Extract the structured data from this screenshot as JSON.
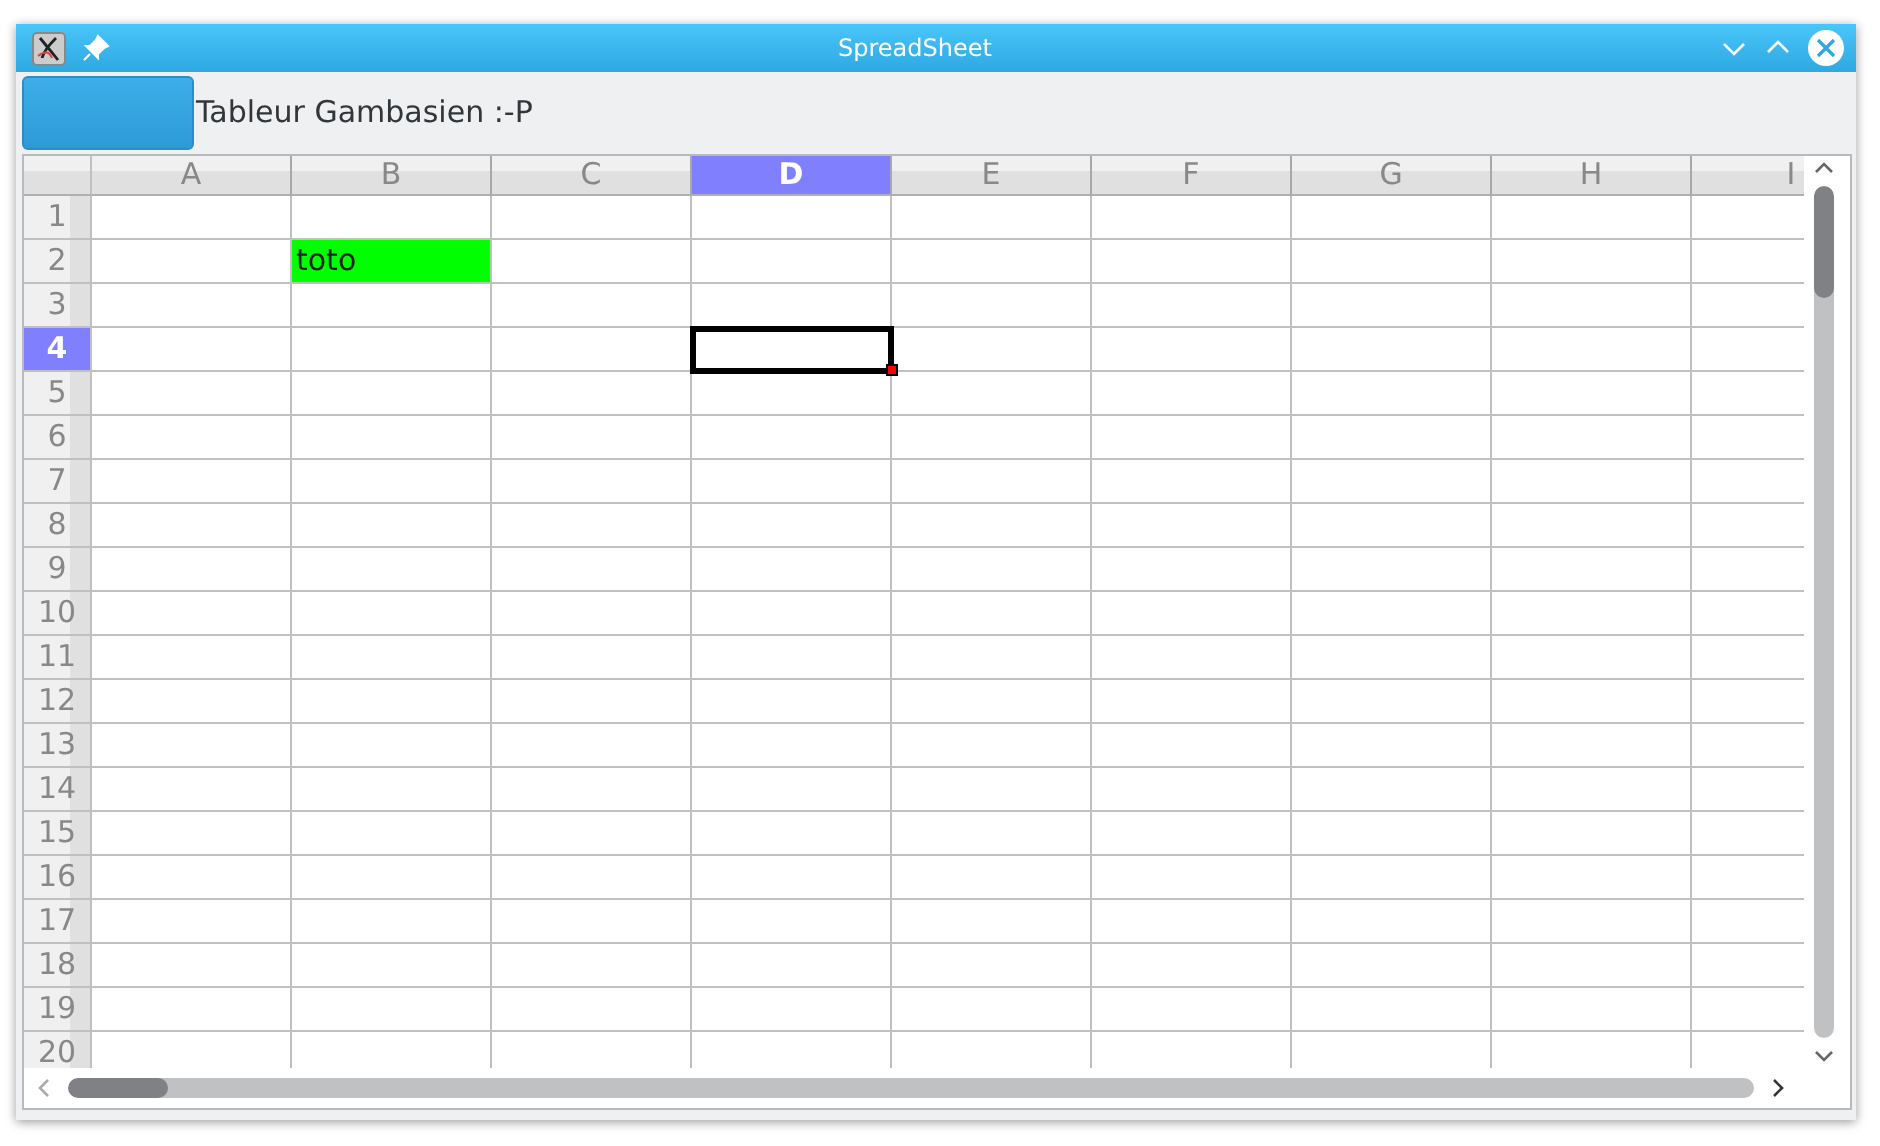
{
  "window": {
    "title": "SpreadSheet"
  },
  "toolbar": {
    "label": "Tableur Gambasien :-P"
  },
  "columns": [
    {
      "label": "A",
      "selected": false
    },
    {
      "label": "B",
      "selected": false
    },
    {
      "label": "C",
      "selected": false
    },
    {
      "label": "D",
      "selected": true
    },
    {
      "label": "E",
      "selected": false
    },
    {
      "label": "F",
      "selected": false
    },
    {
      "label": "G",
      "selected": false
    },
    {
      "label": "H",
      "selected": false
    },
    {
      "label": "I",
      "selected": false
    }
  ],
  "rows": [
    {
      "label": "1",
      "selected": false
    },
    {
      "label": "2",
      "selected": false,
      "cells": [
        {},
        {
          "text": "toto",
          "color": "#00ff00"
        }
      ]
    },
    {
      "label": "3",
      "selected": false
    },
    {
      "label": "4",
      "selected": true,
      "cells": [
        {},
        {},
        {},
        {
          "current": true
        }
      ]
    },
    {
      "label": "5",
      "selected": false
    },
    {
      "label": "6",
      "selected": false
    },
    {
      "label": "7",
      "selected": false
    },
    {
      "label": "8",
      "selected": false
    },
    {
      "label": "9",
      "selected": false
    },
    {
      "label": "10",
      "selected": false
    },
    {
      "label": "11",
      "selected": false
    },
    {
      "label": "12",
      "selected": false
    },
    {
      "label": "13",
      "selected": false
    },
    {
      "label": "14",
      "selected": false
    },
    {
      "label": "15",
      "selected": false
    },
    {
      "label": "16",
      "selected": false
    },
    {
      "label": "17",
      "selected": false
    },
    {
      "label": "18",
      "selected": false
    },
    {
      "label": "19",
      "selected": false
    },
    {
      "label": "20",
      "selected": false
    }
  ]
}
